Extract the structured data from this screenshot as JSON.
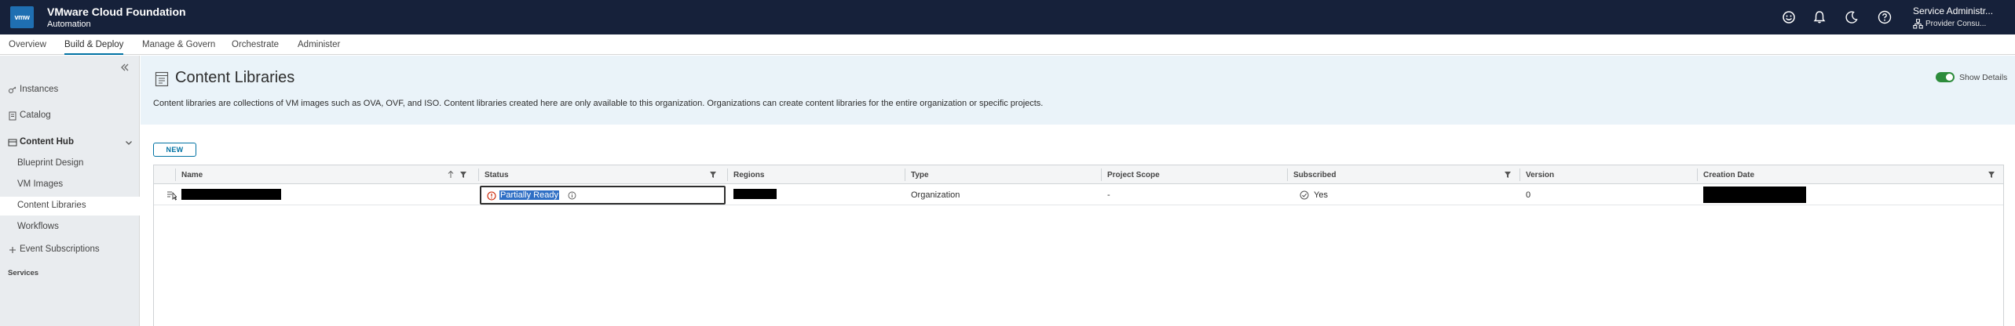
{
  "app": {
    "logo_text": "vmw",
    "title": "VMware Cloud Foundation",
    "subtitle": "Automation",
    "user_name": "Service Administr...",
    "user_org": "Provider Consu..."
  },
  "topnav": {
    "tabs": [
      {
        "label": "Overview"
      },
      {
        "label": "Build & Deploy"
      },
      {
        "label": "Manage & Govern"
      },
      {
        "label": "Orchestrate"
      },
      {
        "label": "Administer"
      }
    ],
    "active_tab": "Build & Deploy"
  },
  "sidebar": {
    "items": [
      {
        "label": "Instances",
        "icon": "instances-icon"
      },
      {
        "label": "Catalog",
        "icon": "catalog-icon"
      },
      {
        "label": "Content Hub",
        "icon": "content-hub-icon",
        "expanded": true
      },
      {
        "label": "Blueprint Design"
      },
      {
        "label": "VM Images"
      },
      {
        "label": "Content Libraries",
        "active": true
      },
      {
        "label": "Workflows"
      },
      {
        "label": "Event Subscriptions",
        "icon": "plus-icon"
      }
    ],
    "section_label": "Services"
  },
  "page": {
    "title": "Content Libraries",
    "description": "Content libraries are collections of VM images such as OVA, OVF, and ISO. Content libraries created here are only available to this organization. Organizations can create content libraries for the entire organization or specific projects.",
    "show_details_label": "Show Details",
    "show_details_on": true,
    "new_button_label": "NEW"
  },
  "table": {
    "columns": [
      "Name",
      "Status",
      "Regions",
      "Type",
      "Project Scope",
      "Subscribed",
      "Version",
      "Creation Date"
    ],
    "rows": [
      {
        "name": "[redacted]",
        "status": "Partially Ready",
        "regions": "[redacted]",
        "type": "Organization",
        "project_scope": "-",
        "subscribed": "Yes",
        "version": "0",
        "creation_date": "[redacted]"
      }
    ]
  },
  "colors": {
    "header_bg": "#16213a",
    "accent": "#0072a3",
    "banner_bg": "#eaf3f9",
    "sidebar_bg": "#e9ecef",
    "toggle_on": "#2d8c3c",
    "warning": "#c92100",
    "selection": "#2f6fc5"
  }
}
